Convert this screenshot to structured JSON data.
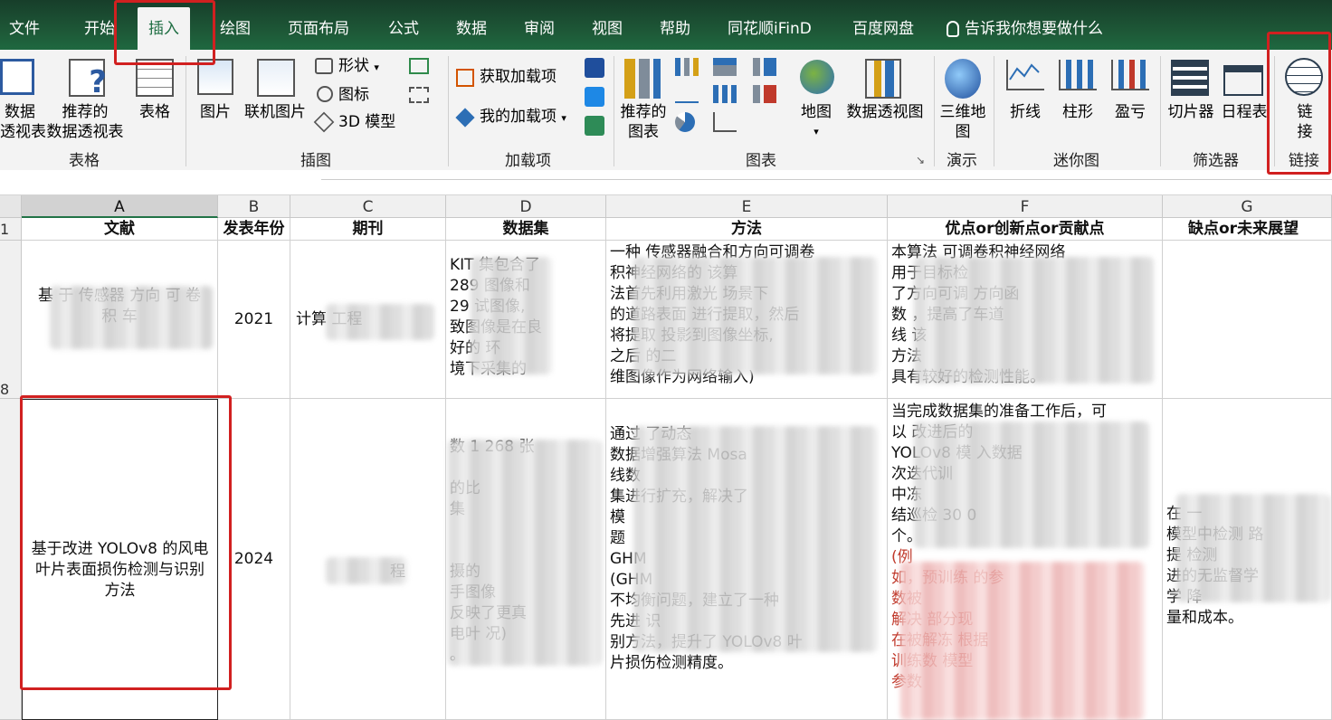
{
  "tabs": [
    "文件",
    "开始",
    "插入",
    "绘图",
    "页面布局",
    "公式",
    "数据",
    "审阅",
    "视图",
    "帮助",
    "同花顺iFinD",
    "百度网盘"
  ],
  "active_tab": "插入",
  "tell_me": "告诉我你想要做什么",
  "ribbon": {
    "table_group": {
      "label": "表格",
      "pivot": [
        "数据",
        "透视表"
      ],
      "recommended_pivot": [
        "推荐的",
        "数据透视表"
      ],
      "table": "表格"
    },
    "illustrations_group": {
      "label": "插图",
      "pictures": "图片",
      "online_pictures": "联机图片",
      "shapes": "形状",
      "icons": "图标",
      "models3d": "3D 模型"
    },
    "addins_group": {
      "label": "加载项",
      "get": "获取加载项",
      "my": "我的加载项"
    },
    "charts_group": {
      "label": "图表",
      "recommended": [
        "推荐的",
        "图表"
      ],
      "maps": "地图",
      "pivot_chart": "数据透视图"
    },
    "tours_group": {
      "label": "演示",
      "map3d": [
        "三维地",
        "图"
      ]
    },
    "sparklines_group": {
      "label": "迷你图",
      "line": "折线",
      "column": "柱形",
      "winloss": "盈亏"
    },
    "filters_group": {
      "label": "筛选器",
      "slicer": "切片器",
      "timeline": "日程表"
    },
    "links_group": {
      "label": "链接",
      "link": [
        "链",
        "接"
      ]
    }
  },
  "columns": [
    "A",
    "B",
    "C",
    "D",
    "E",
    "F",
    "G"
  ],
  "rows": [
    "1",
    "8"
  ],
  "header": {
    "a": "文献",
    "b": "发表年份",
    "c": "期刊",
    "d": "数据集",
    "e": "方法",
    "f": "优点or创新点or贡献点",
    "g": "缺点or未来展望"
  },
  "row8": {
    "a": "基 于 传感器 方向 可 卷 积 车",
    "b": "2021",
    "c": "计算 工程",
    "d": [
      "KIT 集包含了",
      "289 图像和",
      "29 试图像,",
      "致图像是在良",
      "好的 环",
      "境下采集的"
    ],
    "e": [
      "一种 传感器融合和方向可调卷",
      "积神经网络的 该算",
      "法首先利用激光 场景下",
      "的道路表面 进行提取，然后",
      "将提取 投影到图像坐标,",
      "之后 的二",
      "维图像作为网络输入)"
    ],
    "f": [
      "本算法 可调卷积神经网络",
      "用于目标检 ",
      "了方向可调 方向函",
      "数 ，提高了车道",
      "线 该",
      "方法 ",
      "具有较好的检测性能。"
    ]
  },
  "row9": {
    "a": "基于改进 YOLOv8 的风电叶片表面损伤检测与识别方法",
    "b": "2024",
    "c": "程",
    "d": [
      "数 1 268 张",
      "",
      "的比",
      "集",
      "",
      "",
      "摄的",
      "手图像",
      "反映了更真",
      "电叶 况)",
      "。"
    ],
    "e": [
      "通过 了动态",
      "数据增强算法 Mosa",
      "线数",
      "集进行扩充，解决了",
      "模",
      "题",
      "GHM",
      "(GHM",
      "不均衡问题，建立了一种",
      "先进 识",
      "别方法，提升了 YOLOv8 叶",
      "片损伤检测精度。"
    ],
    "f": [
      "当完成数据集的准备工作后，可",
      "以 改进后的",
      "YOLOv8 模 入数据",
      "次迭代训",
      "中冻",
      "结巡检 30 0",
      "个。",
      "(例",
      "如，预训练 的参",
      "数被",
      "解决 部分现",
      "在被解冻 根据",
      "训练数 模型",
      "参数 "
    ],
    "g": [
      "在 一",
      "模型中检测 路",
      "提 检测",
      "进的无监督学",
      "学 降",
      "量和成本。"
    ]
  }
}
